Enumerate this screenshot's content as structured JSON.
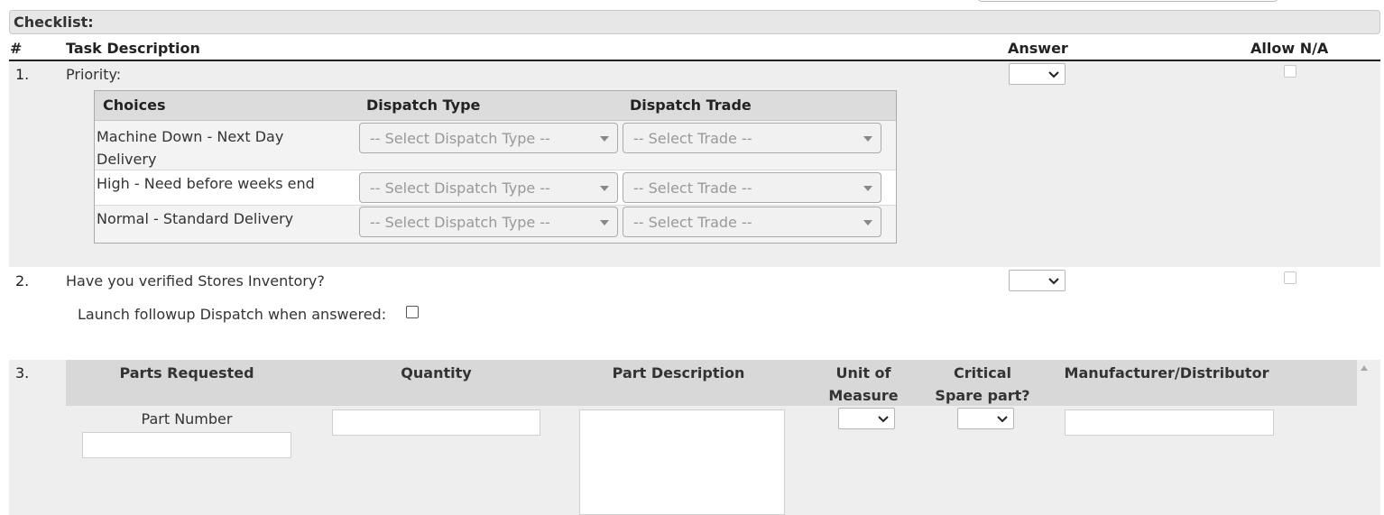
{
  "checklist": {
    "section_title": "Checklist:",
    "headers": {
      "num": "#",
      "task": "Task Description",
      "answer": "Answer",
      "allow_na": "Allow N/A"
    },
    "items": [
      {
        "num": "1.",
        "label": "Priority:",
        "answer_value": ""
      },
      {
        "num": "2.",
        "label": "Have you verified Stores Inventory?",
        "answer_value": "",
        "launch_label": "Launch followup Dispatch when answered:"
      },
      {
        "num": "3."
      }
    ],
    "choices_table": {
      "headers": {
        "choices": "Choices",
        "dispatch_type": "Dispatch Type",
        "dispatch_trade": "Dispatch Trade"
      },
      "rows": [
        {
          "choice_line1": "Machine Down - Next Day",
          "choice_line2": "Delivery",
          "type_placeholder": "-- Select Dispatch Type --",
          "trade_placeholder": "-- Select Trade --"
        },
        {
          "choice_line1": "High - Need before weeks end",
          "choice_line2": "",
          "type_placeholder": "-- Select Dispatch Type --",
          "trade_placeholder": "-- Select Trade --"
        },
        {
          "choice_line1": "Normal - Standard Delivery",
          "choice_line2": "",
          "type_placeholder": "-- Select Dispatch Type --",
          "trade_placeholder": "-- Select Trade --"
        }
      ]
    },
    "parts_table": {
      "headers": {
        "parts_requested": "Parts Requested",
        "quantity": "Quantity",
        "part_description": "Part Description",
        "uom_line1": "Unit of",
        "uom_line2": "Measure",
        "critical_line1": "Critical",
        "critical_line2": "Spare part?",
        "manufacturer": "Manufacturer/Distributor"
      },
      "part_number_label": "Part Number",
      "values": {
        "part_number": "",
        "quantity": "",
        "part_description": "",
        "uom": "",
        "critical": "",
        "manufacturer": ""
      }
    }
  }
}
